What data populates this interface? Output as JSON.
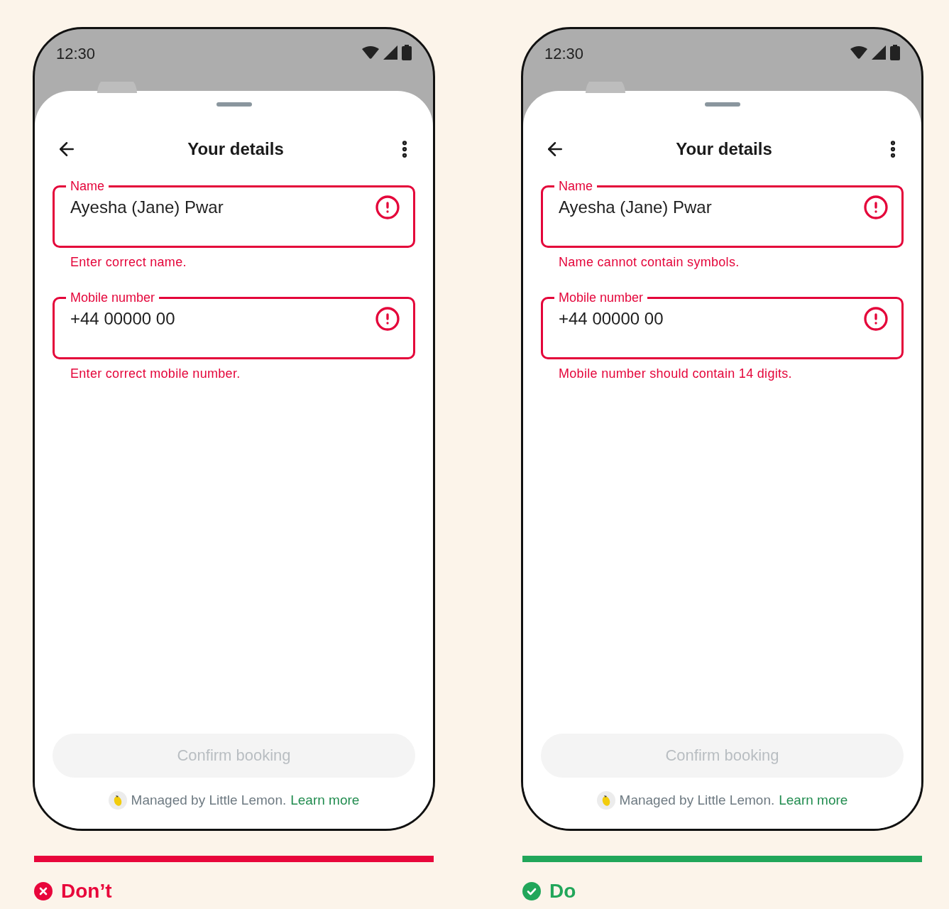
{
  "panels": [
    {
      "phone": {
        "time": "12:30",
        "title": "Your details",
        "fields": [
          {
            "label": "Name",
            "value": "Ayesha (Jane) Pwar",
            "invalid": true,
            "error": "Enter correct name."
          },
          {
            "label": "Mobile number",
            "value": "+44 00000 00",
            "invalid": true,
            "error": "Enter correct mobile number."
          }
        ],
        "button": {
          "label": "Confirm booking",
          "disabled": true
        },
        "footer": {
          "text": "Managed by Little Lemon.",
          "link": "Learn more"
        }
      },
      "verdict": {
        "kind": "dont",
        "label": "Don’t"
      }
    },
    {
      "phone": {
        "time": "12:30",
        "title": "Your details",
        "fields": [
          {
            "label": "Name",
            "value": "Ayesha (Jane) Pwar",
            "invalid": true,
            "error": "Name cannot contain symbols."
          },
          {
            "label": "Mobile number",
            "value": "+44 00000 00",
            "invalid": true,
            "error": "Mobile number should contain 14 digits."
          }
        ],
        "button": {
          "label": "Confirm booking",
          "disabled": true
        },
        "footer": {
          "text": "Managed by Little Lemon.",
          "link": "Learn more"
        }
      },
      "verdict": {
        "kind": "do",
        "label": "Do"
      }
    }
  ]
}
